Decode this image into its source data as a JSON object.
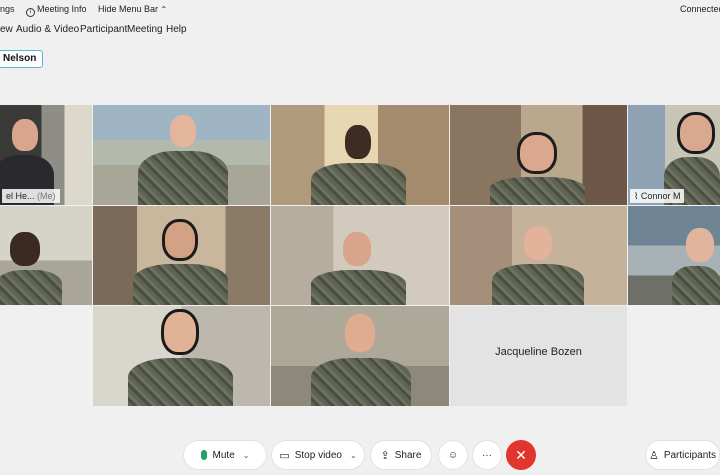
{
  "top_bar": {
    "settings_fragment": "ngs",
    "meeting_info": "Meeting Info",
    "hide_menu_bar": "Hide Menu Bar",
    "connection": "Connected"
  },
  "menu": {
    "items": [
      "ew",
      "Audio & Video",
      "Participant",
      "Meeting",
      "Help"
    ]
  },
  "active_speaker": "Nelson",
  "tiles": {
    "self_label": "el He...",
    "self_suffix": "(Me)",
    "connor_label": "Connor M",
    "jacqueline": "Jacqueline Bozen"
  },
  "controls": {
    "mute": "Mute",
    "stop_video": "Stop video",
    "share": "Share",
    "more": "···",
    "end": "✕",
    "participants": "Participants"
  },
  "colors": {
    "accent": "#28a7d8",
    "end_call": "#e2362d",
    "mic_green": "#21a366"
  }
}
